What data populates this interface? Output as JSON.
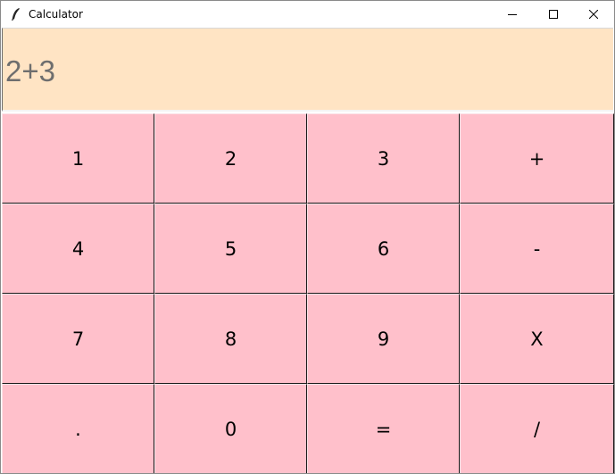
{
  "window": {
    "title": "Calculator"
  },
  "titlebar_controls": {
    "minimize_icon": "minimize-icon",
    "maximize_icon": "maximize-icon",
    "close_icon": "close-icon"
  },
  "display": {
    "value": "2+3",
    "background_color": "#ffe4c4",
    "text_color": "#6e6e6e"
  },
  "keypad": {
    "button_color": "#ffc0cb",
    "keys": [
      {
        "label": "1"
      },
      {
        "label": "2"
      },
      {
        "label": "3"
      },
      {
        "label": "+"
      },
      {
        "label": "4"
      },
      {
        "label": "5"
      },
      {
        "label": "6"
      },
      {
        "label": "-"
      },
      {
        "label": "7"
      },
      {
        "label": "8"
      },
      {
        "label": "9"
      },
      {
        "label": "X"
      },
      {
        "label": "."
      },
      {
        "label": "0"
      },
      {
        "label": "="
      },
      {
        "label": "/"
      }
    ]
  }
}
